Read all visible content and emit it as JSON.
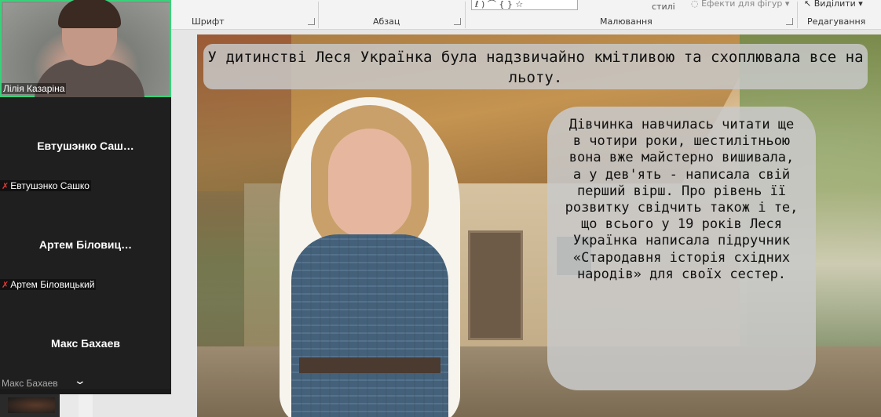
{
  "ribbon": {
    "group_font": "Шрифт",
    "group_paragraph": "Абзац",
    "group_drawing": "Малювання",
    "group_editing": "Редагування",
    "styles_label": "стилі",
    "shape_effects_label": "Ефекти для фігур",
    "select_label": "Виділити",
    "shape_glyphs": "ℓ  ) ⌒ { }  ☆"
  },
  "slide": {
    "caption_top": "У дитинстві Леся Українка була надзвичайно кмітливою та схоплювала все на льоту.",
    "caption_right": "Дівчинка навчилась читати ще в чотири роки, шестилітньою вона вже майстерно вишивала, а у дев'ять - написала свій перший вірш. Про рівень її розвитку свідчить також і те, що всього у 19 років Леся Українка написала підручник «Стародавня історія східних народів» для своїх сестер."
  },
  "participants": {
    "active_name": "Лілія Казаріна",
    "tiles": [
      {
        "title": "Евтушэнко  Саш…",
        "name": "Евтушэнко Сашко",
        "muted": true
      },
      {
        "title": "Артем  Біловиц…",
        "name": "Артем Біловицький",
        "muted": true
      },
      {
        "title": "Макс Бахаев",
        "name": "Макс Бахаев",
        "muted": false
      }
    ]
  },
  "colors": {
    "active_border": "#3ad17a",
    "mute_icon": "#e23b3b"
  }
}
